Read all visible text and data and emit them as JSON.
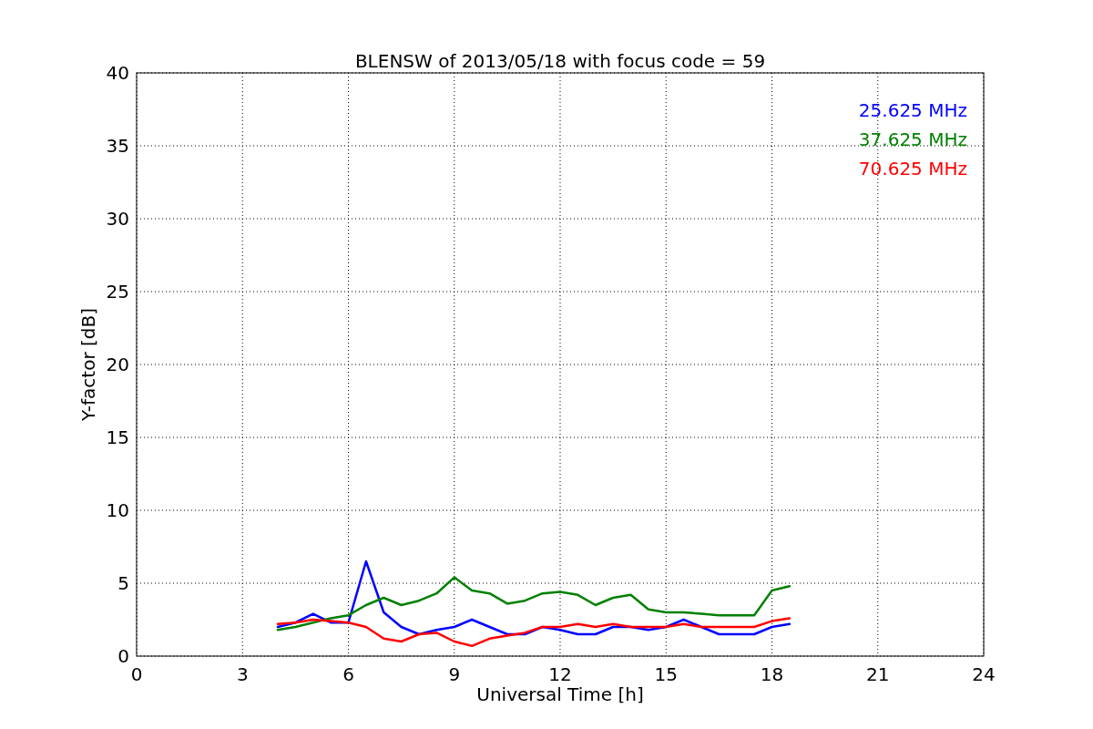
{
  "figure": {
    "chart_data": {
      "type": "line",
      "title": "BLENSW of 2013/05/18 with focus code = 59",
      "xlabel": "Universal Time [h]",
      "ylabel": "Y-factor [dB]",
      "x": [
        4.0,
        4.5,
        5.0,
        5.5,
        6.0,
        6.5,
        7.0,
        7.5,
        8.0,
        8.5,
        9.0,
        9.5,
        10.0,
        10.5,
        11.0,
        11.5,
        12.0,
        12.5,
        13.0,
        13.5,
        14.0,
        14.5,
        15.0,
        15.5,
        16.0,
        16.5,
        17.0,
        17.5,
        18.0,
        18.5
      ],
      "series": [
        {
          "name": "25.625 MHz",
          "color": "#0000ff",
          "values": [
            2.0,
            2.3,
            2.9,
            2.3,
            2.3,
            6.5,
            3.0,
            2.0,
            1.5,
            1.8,
            2.0,
            2.5,
            2.0,
            1.5,
            1.5,
            2.0,
            1.8,
            1.5,
            1.5,
            2.0,
            2.0,
            1.8,
            2.0,
            2.5,
            2.0,
            1.5,
            1.5,
            1.5,
            2.0,
            2.2
          ]
        },
        {
          "name": "37.625 MHz",
          "color": "#008000",
          "values": [
            1.8,
            2.0,
            2.3,
            2.6,
            2.8,
            3.5,
            4.0,
            3.5,
            3.8,
            4.3,
            5.4,
            4.5,
            4.3,
            3.6,
            3.8,
            4.3,
            4.4,
            4.2,
            3.5,
            4.0,
            4.2,
            3.2,
            3.0,
            3.0,
            2.9,
            2.8,
            2.8,
            2.8,
            4.5,
            4.8
          ]
        },
        {
          "name": "70.625 MHz",
          "color": "#ff0000",
          "values": [
            2.2,
            2.3,
            2.5,
            2.4,
            2.3,
            2.0,
            1.2,
            1.0,
            1.5,
            1.6,
            1.0,
            0.7,
            1.2,
            1.4,
            1.6,
            2.0,
            2.0,
            2.2,
            2.0,
            2.2,
            2.0,
            2.0,
            2.0,
            2.2,
            2.0,
            2.0,
            2.0,
            2.0,
            2.4,
            2.6
          ]
        }
      ],
      "grid": true,
      "xlim": [
        0,
        24
      ],
      "ylim": [
        0,
        40
      ],
      "xticks": [
        0,
        3,
        6,
        9,
        12,
        15,
        18,
        21,
        24
      ],
      "yticks": [
        0,
        5,
        10,
        15,
        20,
        25,
        30,
        35,
        40
      ]
    }
  }
}
